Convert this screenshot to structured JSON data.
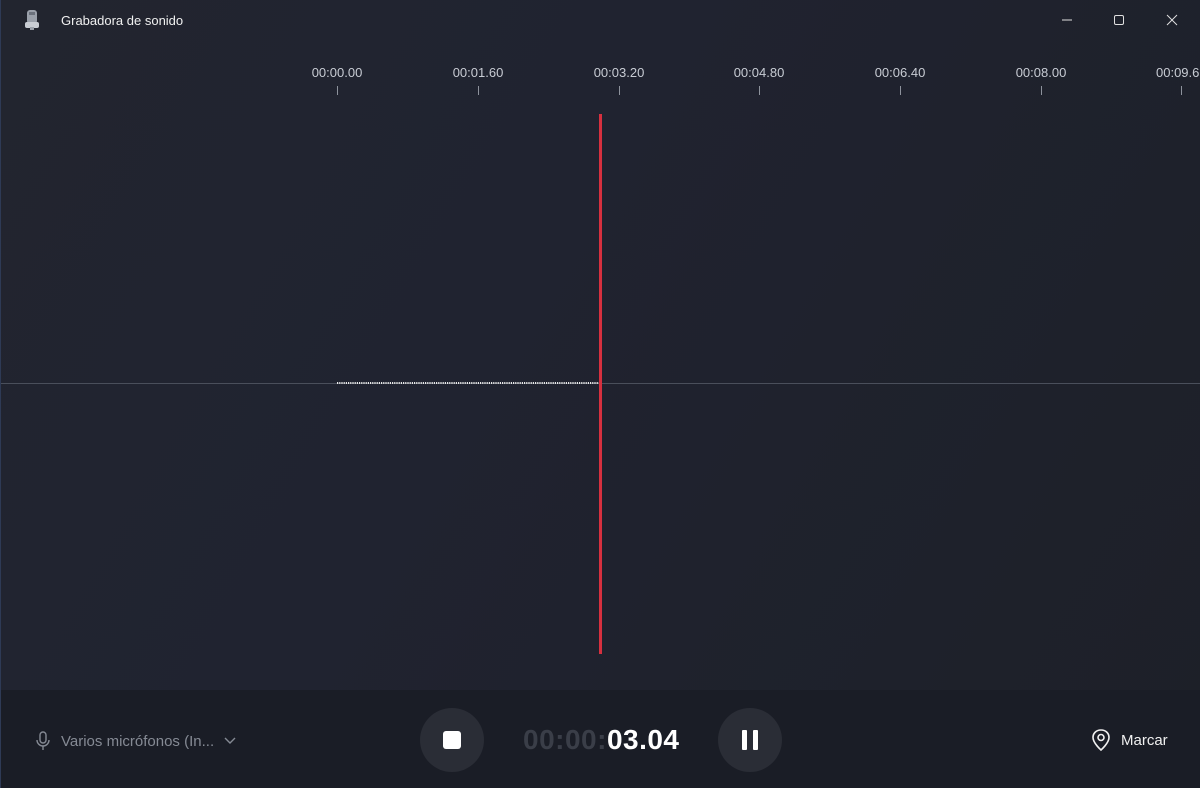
{
  "window": {
    "title": "Grabadora de sonido"
  },
  "timeline": {
    "ticks": [
      "00:00.00",
      "00:01.60",
      "00:03.20",
      "00:04.80",
      "00:06.40",
      "00:08.00",
      "00:09.6"
    ]
  },
  "recording": {
    "playhead_time": "03.04",
    "timer_prefix": "00:00:",
    "timer_value": "03.04"
  },
  "bottombar": {
    "mic_label": "Varios micrófonos (In...",
    "mark_label": "Marcar"
  },
  "colors": {
    "playhead": "#d6303f",
    "background": "#1c1f26"
  },
  "icons": {
    "app": "microphone-app-icon",
    "minimize": "minimize-icon",
    "maximize": "maximize-icon",
    "close": "close-icon",
    "mic": "microphone-icon",
    "chevron": "chevron-down-icon",
    "stop": "stop-icon",
    "pause": "pause-icon",
    "mark": "location-pin-icon"
  }
}
